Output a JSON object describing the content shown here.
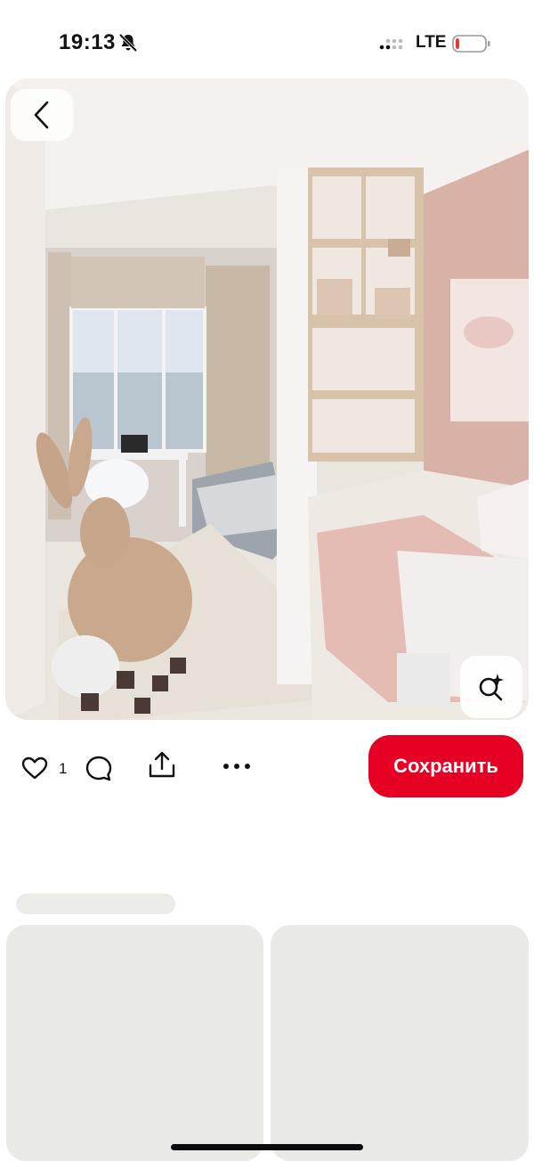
{
  "status_bar": {
    "time": "19:13",
    "network": "LTE",
    "battery_level": 0.12,
    "battery_color": "#e53935",
    "silent_icon": "bell-slash-icon"
  },
  "pin": {
    "image_description_icon": "bedroom-photo",
    "back_icon": "chevron-left-icon",
    "lens_icon": "visual-search-icon"
  },
  "actions": {
    "like_count": "1",
    "save_label": "Сохранить",
    "accent_color": "#e60023",
    "icons": [
      "heart-icon",
      "comment-icon",
      "share-icon",
      "more-icon"
    ]
  }
}
